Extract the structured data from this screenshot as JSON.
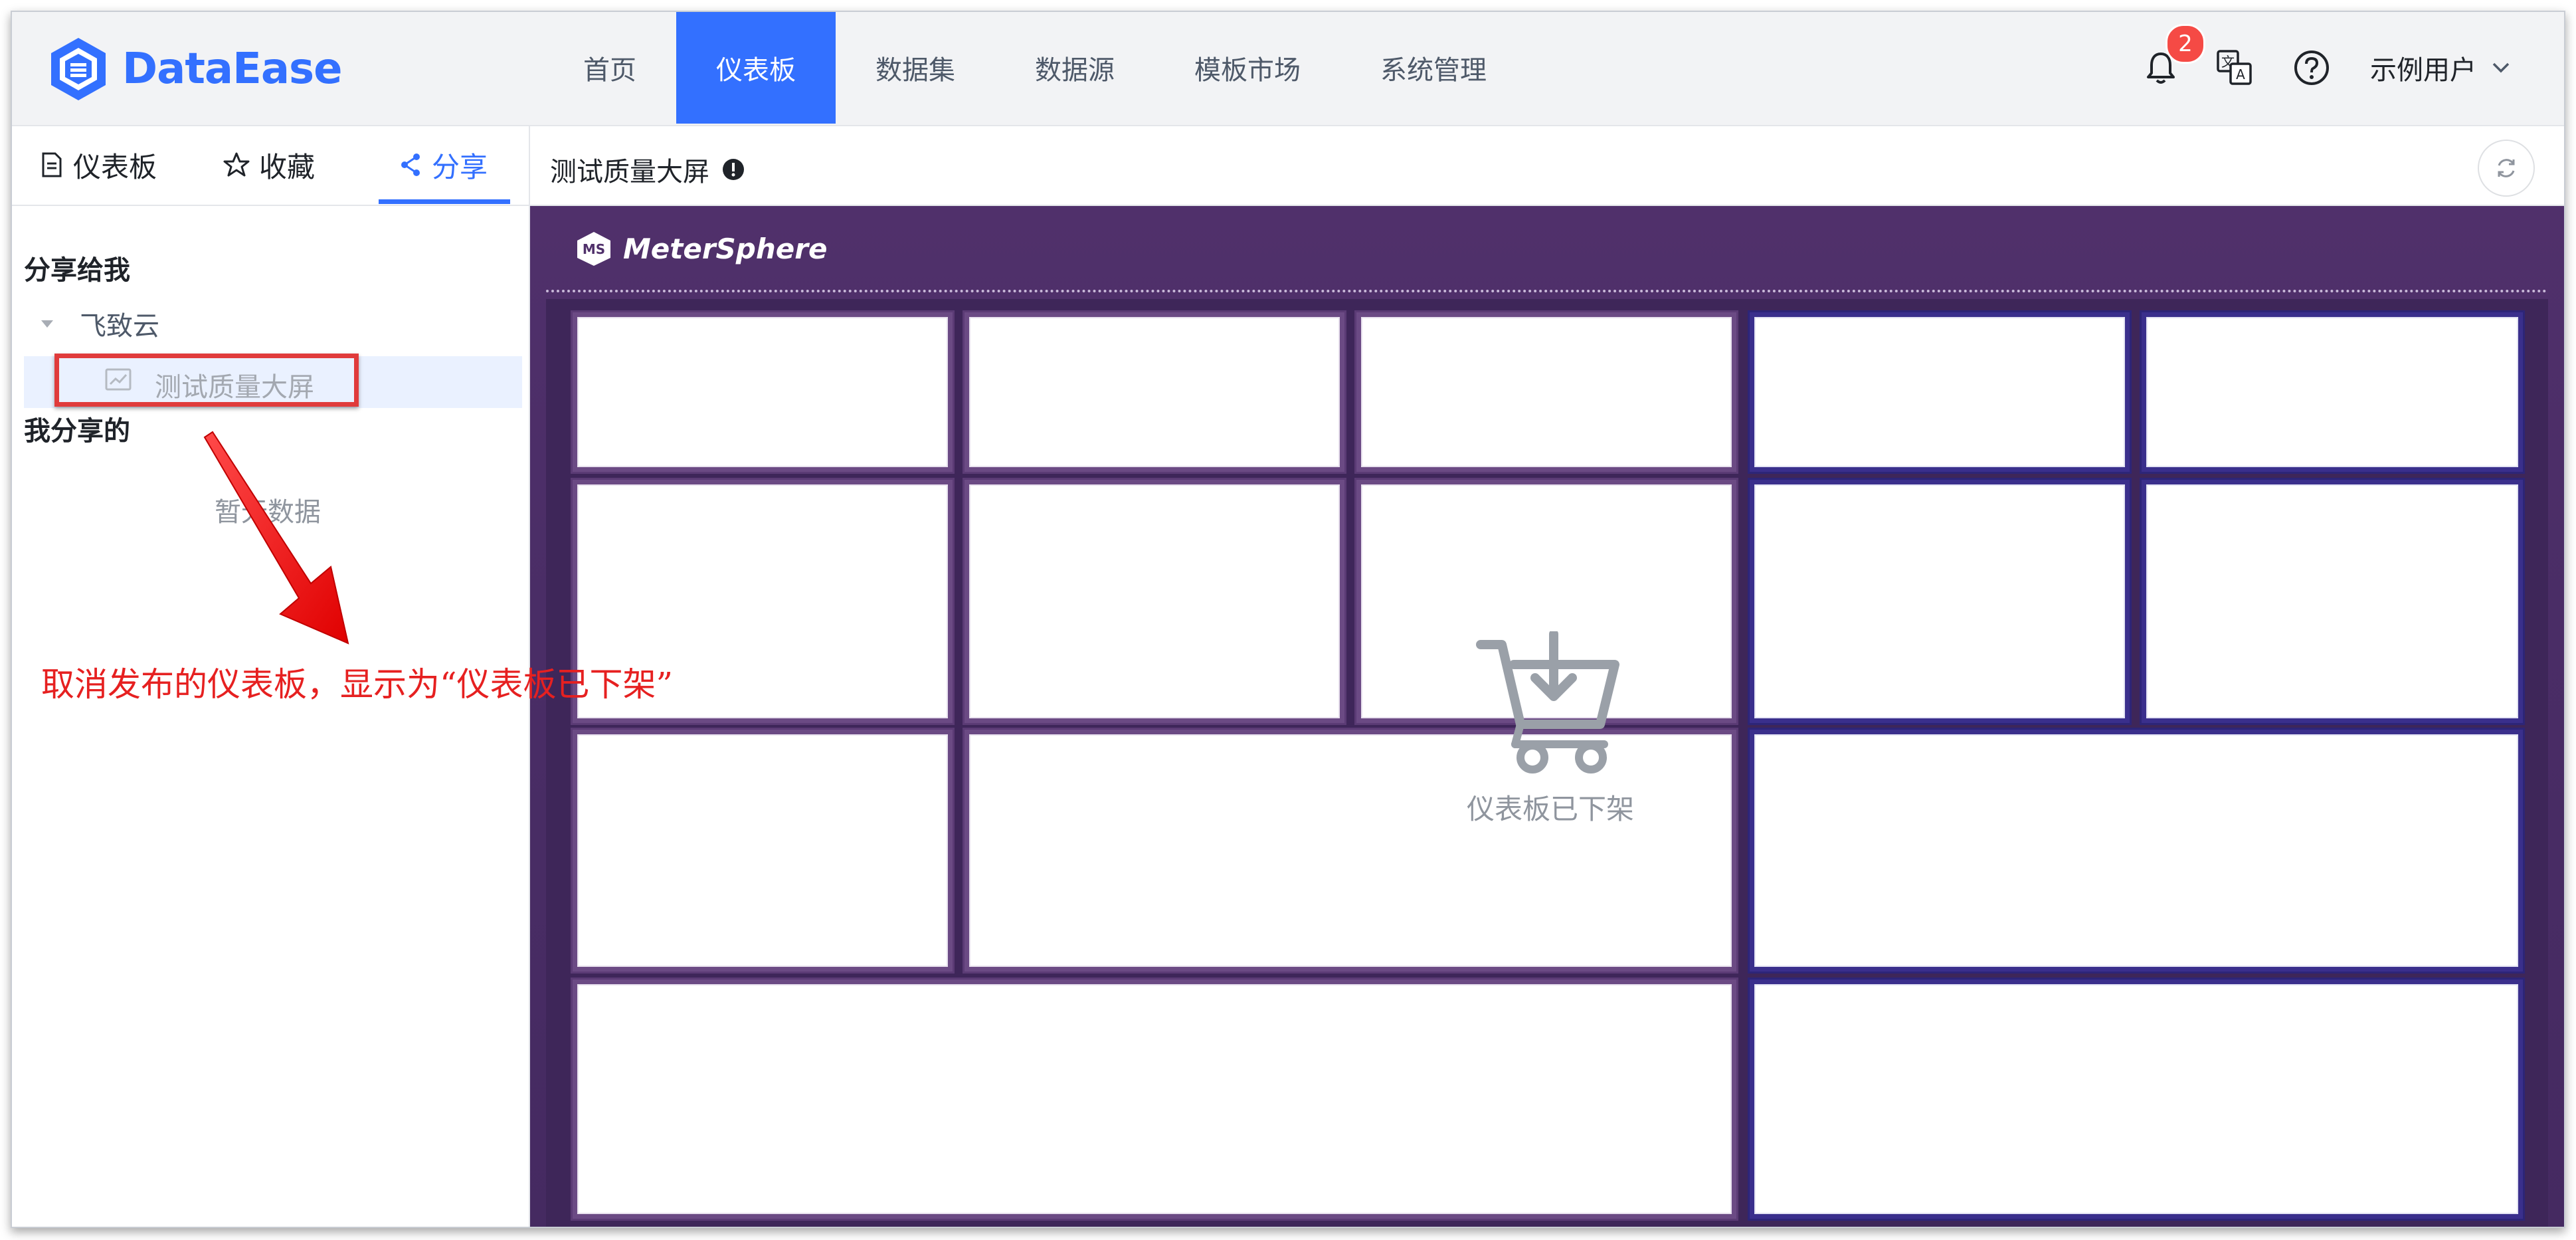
{
  "app": {
    "logo_text": "DataEase",
    "brand_color": "#3370ff"
  },
  "nav": {
    "items": [
      {
        "label": "首页"
      },
      {
        "label": "仪表板"
      },
      {
        "label": "数据集"
      },
      {
        "label": "数据源"
      },
      {
        "label": "模板市场"
      },
      {
        "label": "系统管理"
      }
    ],
    "active": "仪表板"
  },
  "header": {
    "notification_count": "2",
    "user_name": "示例用户"
  },
  "sidebar": {
    "tabs": [
      {
        "label": "仪表板",
        "icon": "document-icon"
      },
      {
        "label": "收藏",
        "icon": "star-icon"
      },
      {
        "label": "分享",
        "icon": "share-icon"
      }
    ],
    "active_tab": "分享",
    "shared_to_me_title": "分享给我",
    "tree_node": "飞致云",
    "tree_leaf": "测试质量大屏",
    "my_shared_title": "我分享的",
    "empty_text": "暂无数据"
  },
  "content": {
    "title": "测试质量大屏",
    "canvas_logo": "MeterSphere",
    "offline_text": "仪表板已下架"
  },
  "annotation": {
    "text": "取消发布的仪表板，显示为“仪表板已下架”",
    "color": "#e62020"
  }
}
